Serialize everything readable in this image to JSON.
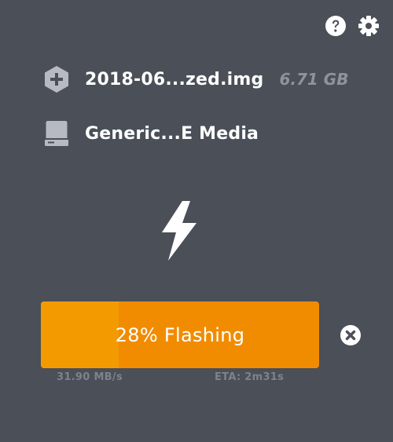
{
  "header": {
    "help_icon": "question-circle-icon",
    "settings_icon": "gear-icon"
  },
  "image": {
    "icon": "hexagon-plus-icon",
    "name": "2018-06...zed.img",
    "size": "6.71 GB"
  },
  "drive": {
    "icon": "hard-drive-icon",
    "name": "Generic...E Media"
  },
  "flash": {
    "icon": "lightning-bolt-icon",
    "progress_percent": 28,
    "status_label": "28% Flashing",
    "speed": "31.90 MB/s",
    "eta": "ETA: 2m31s",
    "cancel_icon": "close-circle-icon"
  },
  "colors": {
    "background": "#4a4f58",
    "progress_bar": "#f18c00",
    "progress_fill": "#f39a00",
    "muted_text": "#7e838b",
    "size_text": "#8f939a"
  }
}
